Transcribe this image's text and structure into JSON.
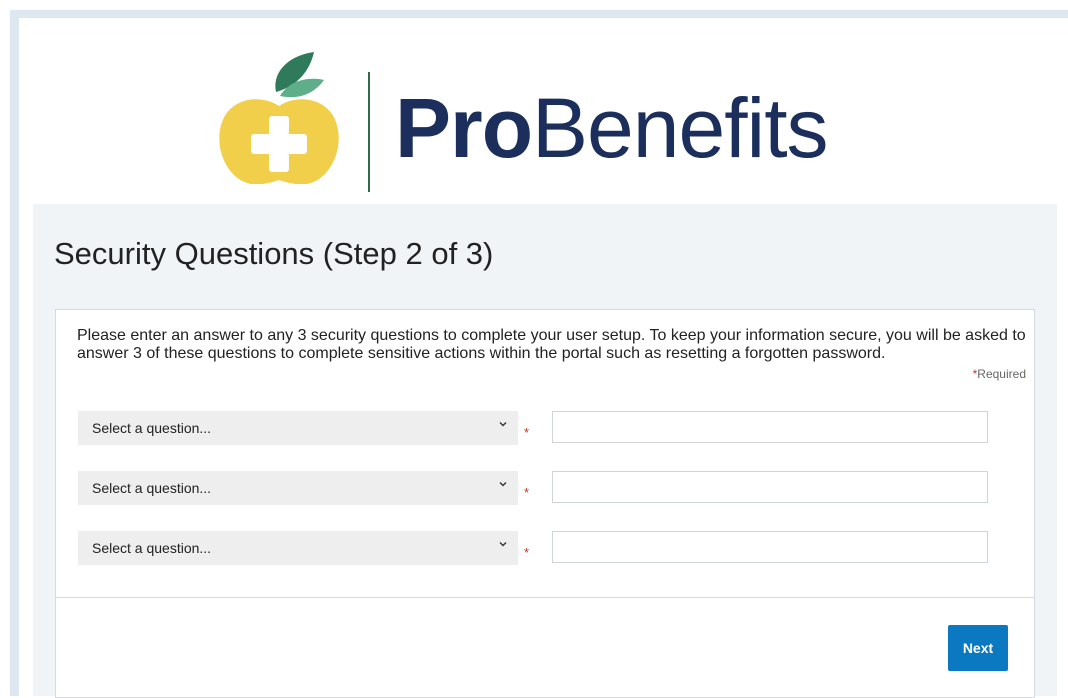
{
  "brand": {
    "name_bold": "Pro",
    "name_regular": "Benefits",
    "logo_icon": "apple-plus-icon",
    "colors": {
      "navy": "#1c2f5c",
      "apple_yellow": "#f1cf4a",
      "leaf_green": "#2f7a5a",
      "accent_blue": "#0a79c2"
    }
  },
  "page": {
    "title": "Security Questions (Step 2 of 3)"
  },
  "form": {
    "instructions": "Please enter an answer to any 3 security questions to complete your user setup. To keep your information secure, you will be asked to answer 3 of these questions to complete sensitive actions within the portal such as resetting a forgotten password.",
    "required_star": "*",
    "required_label": "Required",
    "questions": [
      {
        "select_placeholder": "Select a question...",
        "answer_value": ""
      },
      {
        "select_placeholder": "Select a question...",
        "answer_value": ""
      },
      {
        "select_placeholder": "Select a question...",
        "answer_value": ""
      }
    ],
    "next_label": "Next"
  }
}
